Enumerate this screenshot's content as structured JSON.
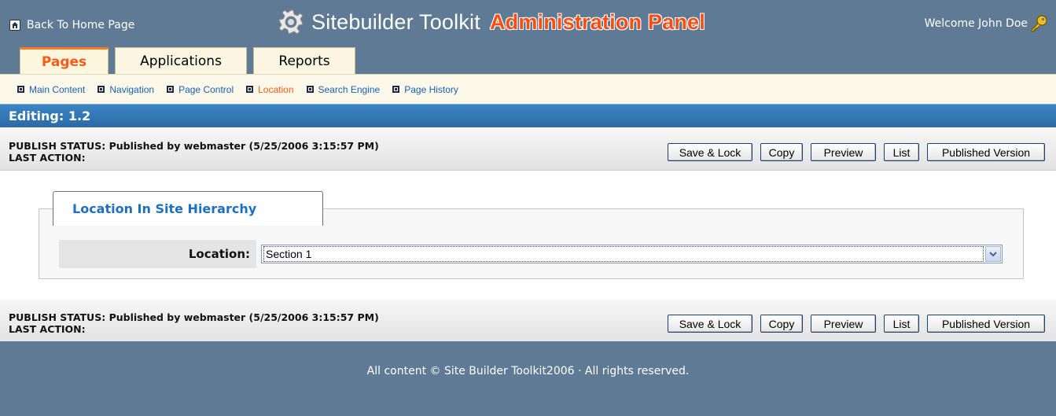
{
  "header": {
    "back_link": "Back To Home Page",
    "brand_name": "Sitebuilder Toolkit",
    "brand_panel": "Administration Panel",
    "welcome": "Welcome John Doe",
    "icons": {
      "home": "home-icon",
      "gear": "gear-icon",
      "key": "key-icon"
    },
    "colors": {
      "background": "#5f7a94",
      "panel_text": "#ff4d12"
    }
  },
  "tabs": [
    {
      "label": "Pages",
      "active": true
    },
    {
      "label": "Applications",
      "active": false
    },
    {
      "label": "Reports",
      "active": false
    }
  ],
  "subnav": [
    {
      "label": "Main Content",
      "active": false
    },
    {
      "label": "Navigation",
      "active": false
    },
    {
      "label": "Page Control",
      "active": false
    },
    {
      "label": "Location",
      "active": true
    },
    {
      "label": "Search Engine",
      "active": false
    },
    {
      "label": "Page History",
      "active": false
    }
  ],
  "editing": {
    "label": "Editing: 1.2"
  },
  "status": {
    "publish": "PUBLISH STATUS: Published by webmaster (5/25/2006 3:15:57 PM)",
    "last_action": "LAST ACTION:"
  },
  "buttons": {
    "save_lock": "Save & Lock",
    "copy": "Copy",
    "preview": "Preview",
    "list": "List",
    "published_version": "Published Version"
  },
  "location_panel": {
    "tab_title": "Location In Site Hierarchy",
    "label": "Location:",
    "selected_value": "Section 1"
  },
  "footer": {
    "text": "All content © Site Builder Toolkit2006 · All rights reserved."
  }
}
